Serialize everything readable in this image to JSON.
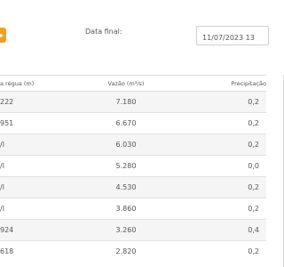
{
  "filter": {
    "date_final_label": "Data final:",
    "date_final_value": "11/07/2023 13"
  },
  "table": {
    "headers": [
      "a régua (m)",
      "Vazão (m³/s)",
      "Precipitação"
    ],
    "rows": [
      [
        "222",
        "7.180",
        "0,2"
      ],
      [
        "951",
        "6.670",
        "0,2"
      ],
      [
        "/l",
        "6.030",
        "0,2"
      ],
      [
        "/l",
        "5.280",
        "0,0"
      ],
      [
        "/l",
        "4.530",
        "0,2"
      ],
      [
        "/l",
        "3.860",
        "0,2"
      ],
      [
        "924",
        "3.260",
        "0,4"
      ],
      [
        "618",
        "2.820",
        "0,2"
      ]
    ]
  },
  "colors": {
    "accent": "#f0a020",
    "row_alt": "#f5f5f5",
    "border": "#dcdcdc"
  },
  "icons": {
    "action_button": "action-icon"
  }
}
